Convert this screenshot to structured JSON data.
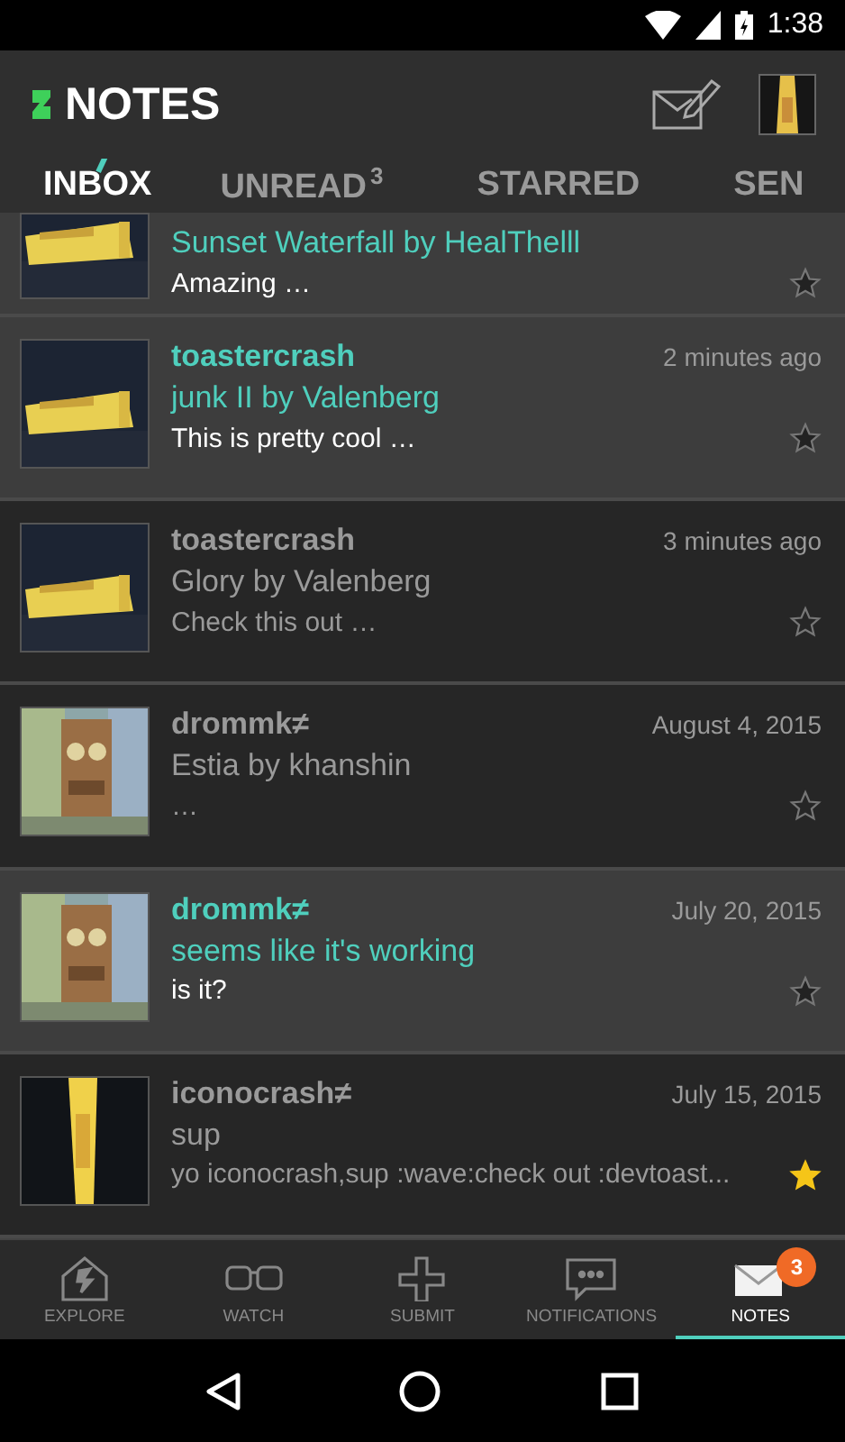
{
  "status_bar": {
    "time": "1:38"
  },
  "toolbar": {
    "title": "NOTES"
  },
  "tabs": [
    {
      "label": "INBOX",
      "selected": true
    },
    {
      "label": "UNREAD",
      "badge": "3",
      "selected": false
    },
    {
      "label": "STARRED",
      "selected": false
    },
    {
      "label": "SEN",
      "selected": false
    }
  ],
  "notes": [
    {
      "title": "Sunset Waterfall by HealThelll",
      "preview": "Amazing …",
      "unread": true,
      "starred": false
    },
    {
      "sender": "toastercrash",
      "time": "2 minutes ago",
      "title": "junk II by Valenberg",
      "preview": "This is pretty cool …",
      "unread": true,
      "starred": false
    },
    {
      "sender": "toastercrash",
      "time": "3 minutes ago",
      "title": "Glory by Valenberg",
      "preview": "Check this out …",
      "unread": false,
      "starred": false
    },
    {
      "sender": "drommk",
      "sender_mark": "≠",
      "time": "August 4, 2015",
      "title": "Estia by khanshin",
      "preview": " …",
      "unread": false,
      "starred": false
    },
    {
      "sender": "drommk",
      "sender_mark": "≠",
      "time": "July 20, 2015",
      "title": "seems like it's working",
      "preview": "is it?",
      "unread": true,
      "starred": false
    },
    {
      "sender": "iconocrash",
      "sender_mark": "≠",
      "time": "July 15, 2015",
      "title": "sup",
      "preview": "yo iconocrash,sup :wave:check out :devtoast...",
      "unread": false,
      "starred": true
    }
  ],
  "bottom_nav": [
    {
      "label": "EXPLORE",
      "selected": false
    },
    {
      "label": "WATCH",
      "selected": false
    },
    {
      "label": "SUBMIT",
      "selected": false
    },
    {
      "label": "NOTIFICATIONS",
      "selected": false
    },
    {
      "label": "NOTES",
      "badge": "3",
      "selected": true
    }
  ]
}
